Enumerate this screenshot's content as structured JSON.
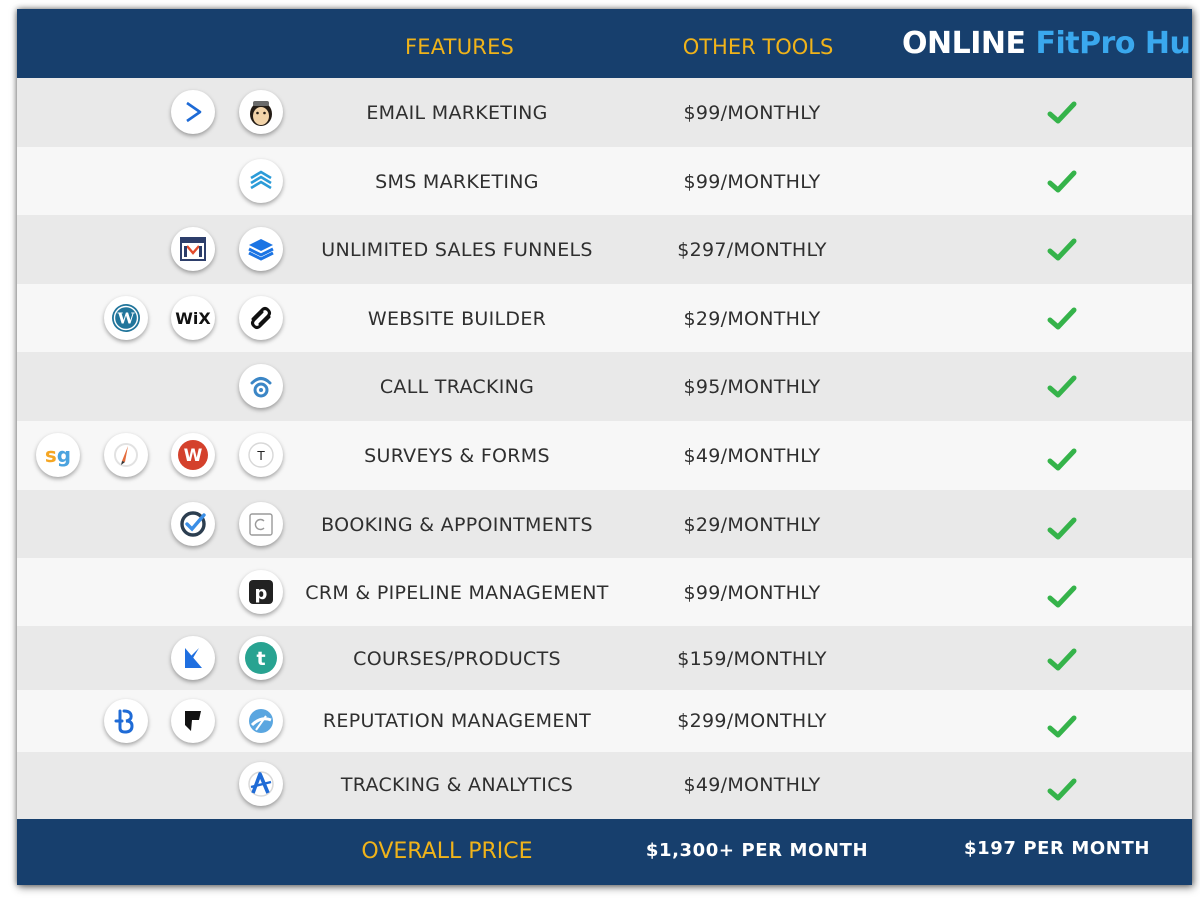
{
  "header": {
    "features": "FEATURES",
    "other_tools": "OTHER TOOLS",
    "brand_prefix": "ONLINE",
    "brand_name": "FitPro Hub"
  },
  "colors": {
    "navy": "#173f6d",
    "gold": "#f0b31a",
    "brand_blue": "#3aa8ee",
    "check_green": "#35b34a"
  },
  "rows": [
    {
      "feature": "EMAIL MARKETING",
      "other_price": "$99/MONTHLY",
      "included": true,
      "icons": [
        "activecampaign-icon",
        "mailchimp-icon"
      ]
    },
    {
      "feature": "SMS MARKETING",
      "other_price": "$99/MONTHLY",
      "included": true,
      "icons": [
        "sms-stack-icon"
      ]
    },
    {
      "feature": "UNLIMITED SALES FUNNELS",
      "other_price": "$297/MONTHLY",
      "included": true,
      "icons": [
        "clickfunnels-icon",
        "leadpages-icon"
      ]
    },
    {
      "feature": "WEBSITE BUILDER",
      "other_price": "$29/MONTHLY",
      "included": true,
      "icons": [
        "wordpress-icon",
        "wix-icon",
        "squarespace-icon"
      ]
    },
    {
      "feature": "CALL TRACKING",
      "other_price": "$95/MONTHLY",
      "included": true,
      "icons": [
        "calltracking-icon"
      ]
    },
    {
      "feature": "SURVEYS & FORMS",
      "other_price": "$49/MONTHLY",
      "included": true,
      "icons": [
        "surveygizmo-icon",
        "formstack-icon",
        "wufoo-icon",
        "typeform-icon"
      ]
    },
    {
      "feature": "BOOKING & APPOINTMENTS",
      "other_price": "$29/MONTHLY",
      "included": true,
      "icons": [
        "acuity-icon",
        "calendly-icon"
      ]
    },
    {
      "feature": "CRM & PIPELINE MANAGEMENT",
      "other_price": "$99/MONTHLY",
      "included": true,
      "icons": [
        "pipedrive-icon"
      ]
    },
    {
      "feature": "COURSES/PRODUCTS",
      "other_price": "$159/MONTHLY",
      "included": true,
      "icons": [
        "kajabi-icon",
        "teachable-icon"
      ]
    },
    {
      "feature": "REPUTATION MANAGEMENT",
      "other_price": "$299/MONTHLY",
      "included": true,
      "icons": [
        "birdeye-icon",
        "foursquare-icon",
        "podium-icon"
      ]
    },
    {
      "feature": "TRACKING & ANALYTICS",
      "other_price": "$49/MONTHLY",
      "included": true,
      "icons": [
        "analytics-icon"
      ]
    }
  ],
  "footer": {
    "label": "OVERALL PRICE",
    "other_total": "$1,300+ PER MONTH",
    "hub_total": "$197 PER MONTH"
  }
}
